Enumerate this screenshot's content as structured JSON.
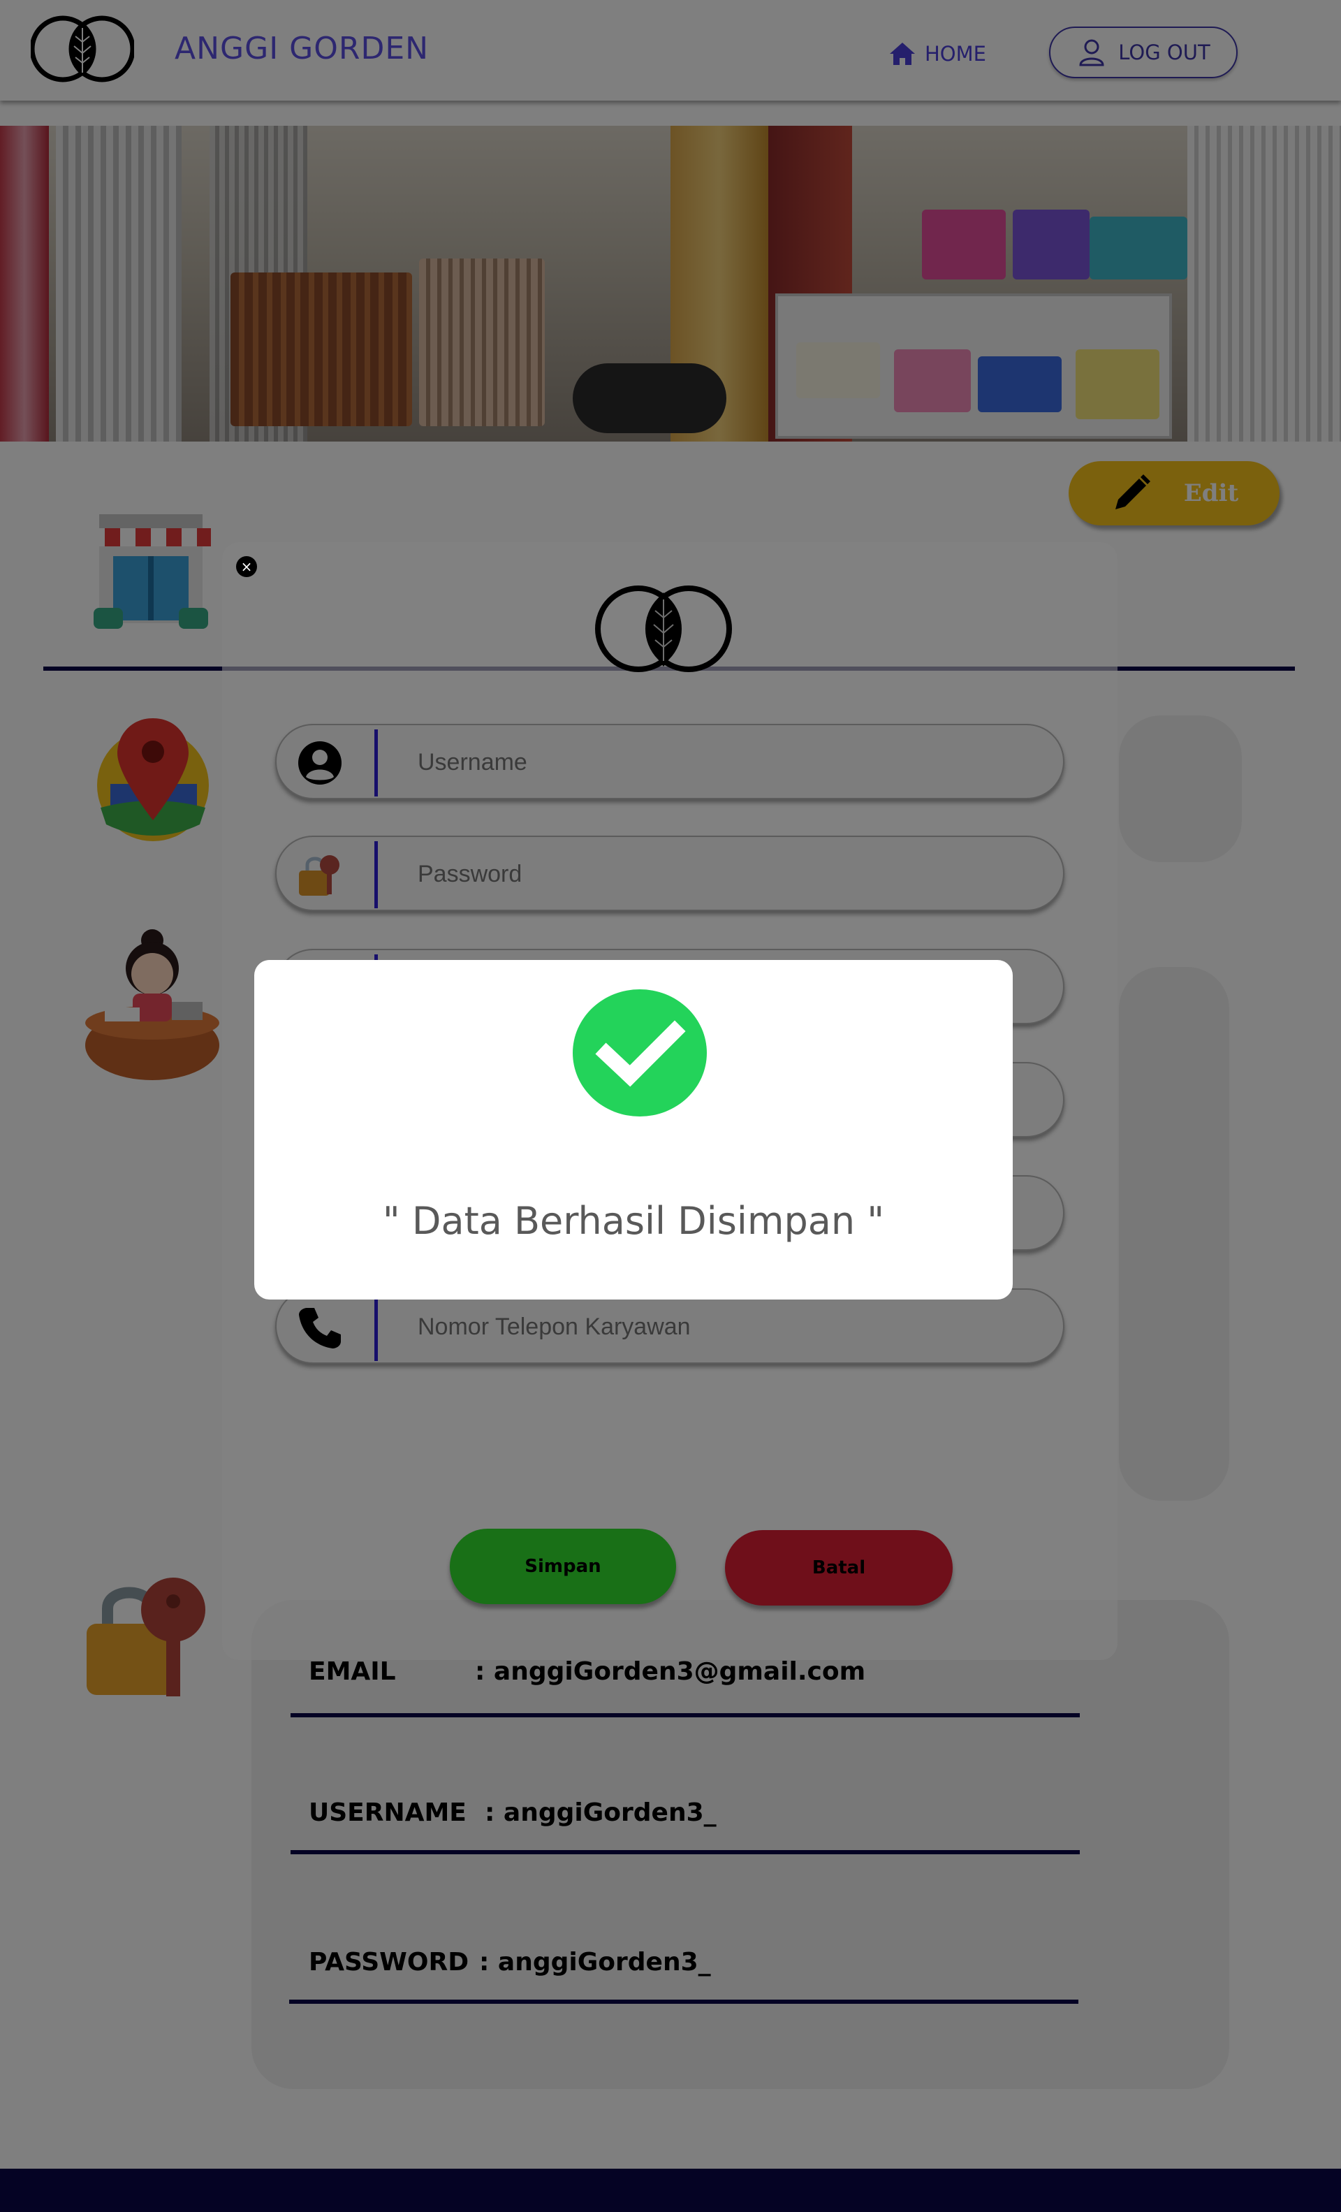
{
  "header": {
    "brand": "ANGGI GORDEN",
    "home_label": "HOME",
    "logout_label": "LOG OUT"
  },
  "edit_label": "Edit",
  "profile": {
    "email_label": "EMAIL",
    "email_value": ": anggiGorden3@gmail.com",
    "username_label": "USERNAME",
    "username_value": ": anggiGorden3_",
    "password_label": "PASSWORD",
    "password_value": ": anggiGorden3_"
  },
  "form": {
    "close_glyph": "×",
    "username_placeholder": "Username",
    "password_placeholder": "Password",
    "phone_placeholder": "Nomor Telepon Karyawan",
    "save_label": "Simpan",
    "cancel_label": "Batal"
  },
  "dialog": {
    "message": "\" Data Berhasil Disimpan \""
  },
  "colors": {
    "brand": "#5b4fe0",
    "navy": "#0b0748",
    "edit": "#f7c21a",
    "save": "#33a832",
    "cancel": "#c8283a",
    "success": "#23d35a"
  }
}
